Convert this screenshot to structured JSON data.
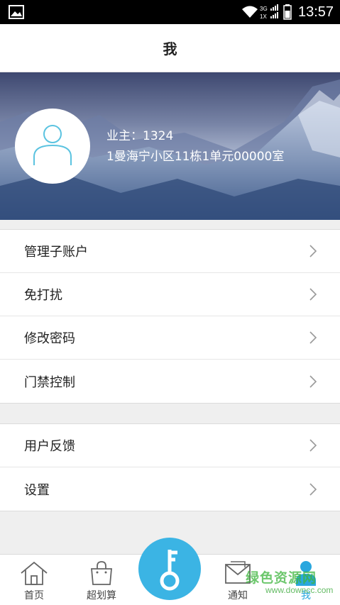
{
  "status_bar": {
    "network": "3G",
    "network2": "1X",
    "time": "13:57"
  },
  "header": {
    "title": "我"
  },
  "profile": {
    "owner_label": "业主：",
    "owner_id": "1324",
    "address": "1曼海宁小区11栋1单元00000室"
  },
  "menu_group_1": [
    {
      "label": "管理子账户",
      "icon": "chevron-right-icon"
    },
    {
      "label": "免打扰",
      "icon": "chevron-right-icon"
    },
    {
      "label": "修改密码",
      "icon": "chevron-right-icon"
    },
    {
      "label": "门禁控制",
      "icon": "chevron-right-icon"
    }
  ],
  "menu_group_2": [
    {
      "label": "用户反馈",
      "icon": "chevron-right-icon"
    },
    {
      "label": "设置",
      "icon": "chevron-right-icon"
    }
  ],
  "bottom_nav": {
    "items": [
      {
        "label": "首页",
        "icon": "home-icon"
      },
      {
        "label": "超划算",
        "icon": "shopping-bag-icon"
      },
      {
        "label": "",
        "icon": "key-icon"
      },
      {
        "label": "通知",
        "icon": "mail-icon"
      },
      {
        "label": "我",
        "icon": "person-icon"
      }
    ],
    "active_index": 4
  },
  "watermark": {
    "title": "绿色资源网",
    "url": "www.downcc.com"
  },
  "colors": {
    "accent": "#3bb4e4",
    "avatar_stroke": "#5bc3e0",
    "active_nav": "#2aa7de"
  }
}
